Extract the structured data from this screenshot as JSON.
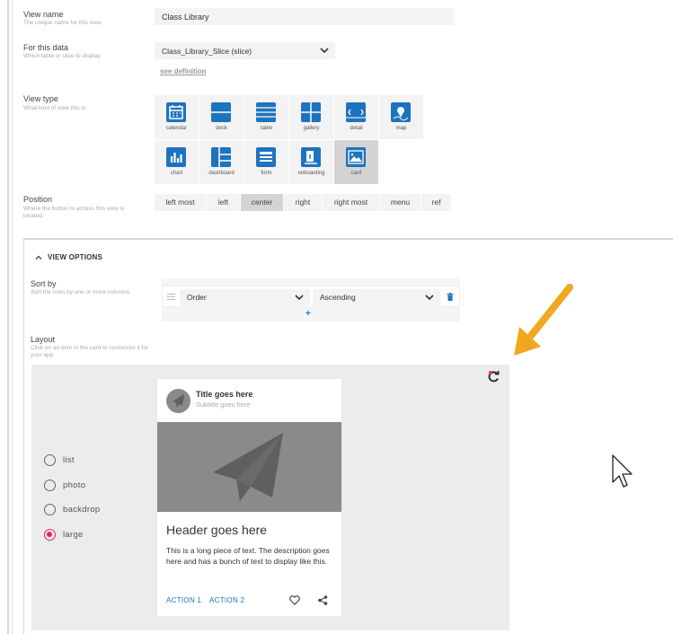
{
  "view_name": {
    "label": "View name",
    "hint": "The unique name for this view.",
    "value": "Class Library"
  },
  "for_data": {
    "label": "For this data",
    "hint": "Which table or slice to display.",
    "value": "Class_Library_Slice (slice)",
    "link": "see definition"
  },
  "view_type": {
    "label": "View type",
    "hint": "What kind of view this is.",
    "options": [
      {
        "label": "calendar",
        "icon": "calendar-icon"
      },
      {
        "label": "deck",
        "icon": "deck-icon"
      },
      {
        "label": "table",
        "icon": "table-icon"
      },
      {
        "label": "gallery",
        "icon": "gallery-icon"
      },
      {
        "label": "detail",
        "icon": "detail-icon"
      },
      {
        "label": "map",
        "icon": "map-icon"
      },
      {
        "label": "chart",
        "icon": "chart-icon"
      },
      {
        "label": "dashboard",
        "icon": "dashboard-icon"
      },
      {
        "label": "form",
        "icon": "form-icon"
      },
      {
        "label": "onboarding",
        "icon": "onboarding-icon"
      },
      {
        "label": "card",
        "icon": "card-icon"
      }
    ],
    "selected": "card"
  },
  "position": {
    "label": "Position",
    "hint": "Where the button to access this view is located.",
    "options": [
      "left most",
      "left",
      "center",
      "right",
      "right most",
      "menu",
      "ref"
    ],
    "selected": "center"
  },
  "view_options": {
    "title": "VIEW OPTIONS",
    "sort_by": {
      "label": "Sort by",
      "hint": "Sort the rows by one or more columns.",
      "column": "Order",
      "direction": "Ascending",
      "add": "+"
    },
    "layout": {
      "label": "Layout",
      "hint": "Click on an item in the card to customize it for your app.",
      "modes": [
        "list",
        "photo",
        "backdrop",
        "large"
      ],
      "selected_mode": "large",
      "card": {
        "title": "Title goes here",
        "subtitle": "Subtitle goes here",
        "header": "Header goes here",
        "description": "This is a long piece of text. The description goes here and has a bunch of text to display like this.",
        "action1": "ACTION 1",
        "action2": "ACTION 2"
      }
    }
  },
  "colors": {
    "accent": "#1e73be",
    "radio_on": "#e91e63",
    "arrow": "#f0a820"
  }
}
